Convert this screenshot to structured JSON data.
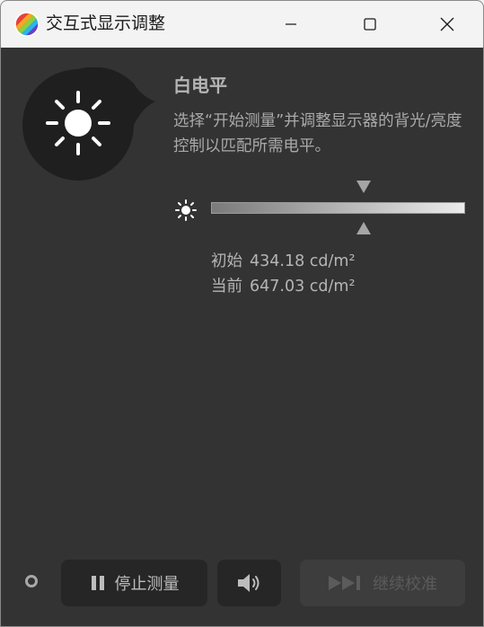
{
  "window": {
    "title": "交互式显示调整"
  },
  "panel": {
    "heading": "白电平",
    "description": "选择“开始测量”并调整显示器的背光/亮度控制以匹配所需电平。",
    "target_position": 0.6,
    "current_position": 0.6
  },
  "readouts": {
    "initial_label": "初始",
    "initial_value": "434.18 cd/m²",
    "current_label": "当前",
    "current_value": "647.03 cd/m²"
  },
  "buttons": {
    "stop_label": "停止测量",
    "continue_label": "继续校准"
  },
  "colors": {
    "background": "#333333",
    "titlebar": "#f3f3f3",
    "button": "#262626",
    "button_disabled": "#3d3d3d"
  }
}
